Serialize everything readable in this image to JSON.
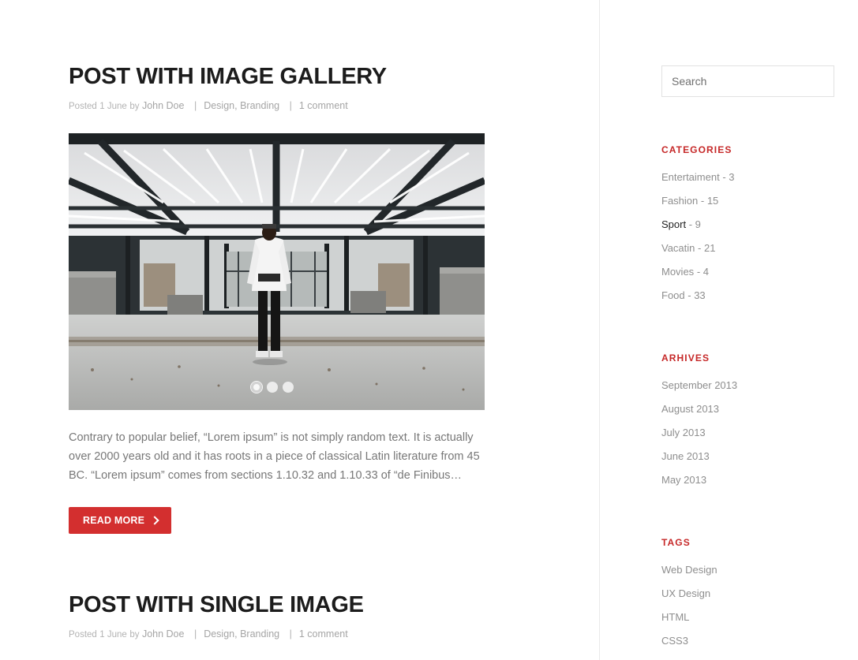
{
  "posts": [
    {
      "title": "POST WITH IMAGE GALLERY",
      "meta": {
        "posted_label": "Posted",
        "date": "1 June",
        "by_label": "by",
        "author": "John Doe",
        "sep": "|",
        "category_1": "Design",
        "comma": ",",
        "category_2": "Branding",
        "comments": "1 comment"
      },
      "gallery": {
        "slide_count": 3,
        "active_slide": 1
      },
      "excerpt": "Contrary to popular belief, “Lorem ipsum” is not simply random text. It is actually over 2000 years old and it has roots in a piece of classical Latin literature from 45 BC. “Lorem ipsum” comes from sections 1.10.32 and 1.10.33 of “de Finibus…",
      "read_more_label": "READ MORE"
    },
    {
      "title": "POST WITH SINGLE IMAGE",
      "meta": {
        "posted_label": "Posted",
        "date": "1 June",
        "by_label": "by",
        "author": "John Doe",
        "sep": "|",
        "category_1": "Design",
        "comma": ",",
        "category_2": "Branding",
        "comments": "1 comment"
      }
    }
  ],
  "sidebar": {
    "search": {
      "placeholder": "Search"
    },
    "categories": {
      "title": "CATEGORIES",
      "items": [
        {
          "name": "Entertaiment",
          "count": "- 3"
        },
        {
          "name": "Fashion",
          "count": "- 15"
        },
        {
          "name": "Sport",
          "count": "- 9"
        },
        {
          "name": "Vacatin",
          "count": "- 21"
        },
        {
          "name": "Movies",
          "count": "- 4"
        },
        {
          "name": "Food",
          "count": "- 33"
        }
      ]
    },
    "archives": {
      "title": "ARHIVES",
      "items": [
        "September 2013",
        "August 2013",
        "July 2013",
        "June 2013",
        "May 2013"
      ]
    },
    "tags": {
      "title": "TAGS",
      "items": [
        "Web Design",
        "UX Design",
        "HTML",
        "CSS3"
      ]
    }
  },
  "colors": {
    "accent": "#d32f2f",
    "widget_title": "#c62828",
    "title_text": "#1c1c1c",
    "meta_text": "#a5a5a5",
    "body_text": "#777777"
  },
  "icons": {
    "read_more": "chevron-right-icon",
    "slider_dot": "slider-dot-icon"
  }
}
